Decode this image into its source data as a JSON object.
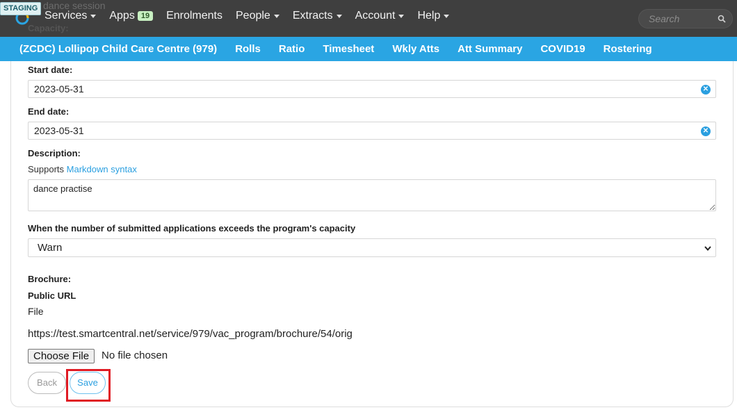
{
  "env_badge": "STAGING",
  "ghost_text": {
    "line1": "dance session",
    "line2": "Capacity:"
  },
  "nav": {
    "items": [
      {
        "label": "Services",
        "caret": true
      },
      {
        "label": "Apps",
        "badge": "19"
      },
      {
        "label": "Enrolments"
      },
      {
        "label": "People",
        "caret": true
      },
      {
        "label": "Extracts",
        "caret": true
      },
      {
        "label": "Account",
        "caret": true
      },
      {
        "label": "Help",
        "caret": true
      }
    ],
    "search_placeholder": "Search"
  },
  "subnav": {
    "items": [
      "(ZCDC) Lollipop Child Care Centre (979)",
      "Rolls",
      "Ratio",
      "Timesheet",
      "Wkly Atts",
      "Att Summary",
      "COVID19",
      "Rostering"
    ]
  },
  "form": {
    "start_date_label": "Start date:",
    "start_date_value": "2023-05-31",
    "end_date_label": "End date:",
    "end_date_value": "2023-05-31",
    "description_label": "Description:",
    "supports_text": "Supports",
    "markdown_link": "Markdown syntax",
    "description_value": "dance practise",
    "capacity_rule_label": "When the number of submitted applications exceeds the program's capacity",
    "capacity_rule_value": "Warn",
    "brochure_label": "Brochure:",
    "public_url_label": "Public URL",
    "file_label": "File",
    "brochure_url": "https://test.smartcentral.net/service/979/vac_program/brochure/54/orig",
    "choose_file_label": "Choose File",
    "no_file_text": "No file chosen",
    "back_label": "Back",
    "save_label": "Save"
  },
  "colors": {
    "topnav_bg": "#3f3f3f",
    "subnav_bg": "#2aa5e3",
    "accent": "#2a9fe0",
    "highlight": "#e01b24"
  }
}
